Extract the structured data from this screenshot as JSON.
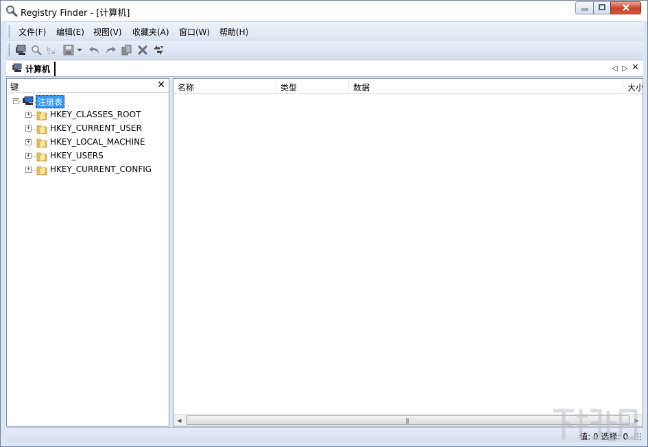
{
  "window": {
    "title": "Registry Finder - [计算机]"
  },
  "menu": {
    "items": [
      {
        "label": "文件(F)"
      },
      {
        "label": "编辑(E)"
      },
      {
        "label": "视图(V)"
      },
      {
        "label": "收藏夹(A)"
      },
      {
        "label": "窗口(W)"
      },
      {
        "label": "帮助(H)"
      }
    ]
  },
  "toolbar": {
    "buttons": [
      {
        "icon": "computer-icon"
      },
      {
        "icon": "find-icon"
      },
      {
        "icon": "replace-icon"
      },
      {
        "icon": "save-icon"
      },
      {
        "icon": "dropdown-arrow-icon"
      },
      {
        "icon": "undo-icon"
      },
      {
        "icon": "redo-icon"
      },
      {
        "icon": "copy-icon"
      },
      {
        "icon": "delete-icon"
      },
      {
        "icon": "refresh-icon"
      }
    ]
  },
  "tabs": [
    {
      "label": "计算机",
      "icon": "computer-icon",
      "active": true
    }
  ],
  "left_pane": {
    "title": "键",
    "tree": {
      "root": {
        "label": "注册表",
        "expanded": true,
        "selected": true
      },
      "children": [
        {
          "label": "HKEY_CLASSES_ROOT"
        },
        {
          "label": "HKEY_CURRENT_USER"
        },
        {
          "label": "HKEY_LOCAL_MACHINE"
        },
        {
          "label": "HKEY_USERS"
        },
        {
          "label": "HKEY_CURRENT_CONFIG"
        }
      ]
    }
  },
  "right_pane": {
    "columns": [
      {
        "label": "名称"
      },
      {
        "label": "类型"
      },
      {
        "label": "数据"
      },
      {
        "label": "大小"
      }
    ],
    "rows": []
  },
  "status": {
    "text": "值: 0 选择: 0"
  },
  "colors": {
    "frame": "#dce7f5",
    "selection": "#3399ff",
    "close_button": "#c7412b"
  }
}
